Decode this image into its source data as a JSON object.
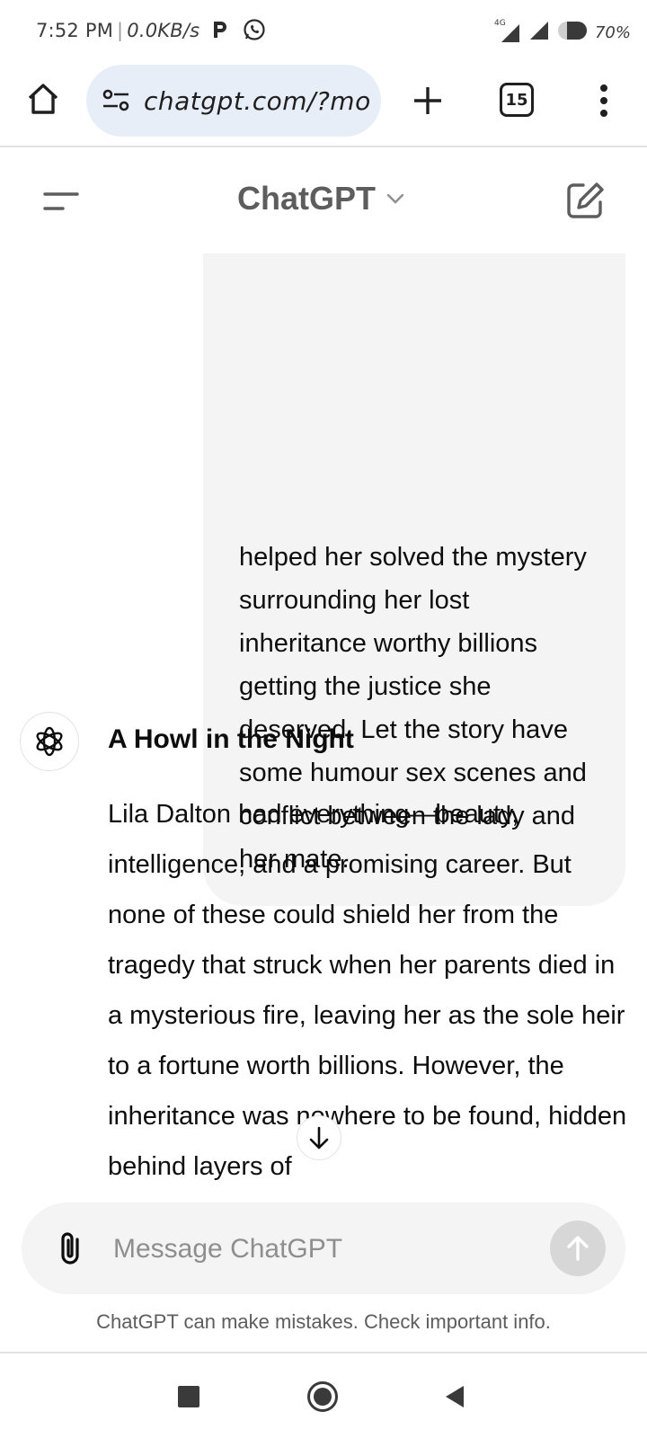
{
  "status_bar": {
    "time": "7:52 PM",
    "separator": "|",
    "network_speed": "0.0KB/s",
    "app_icons": [
      "parking-p-icon",
      "whatsapp-icon"
    ],
    "network_type": "4G",
    "battery_percent": "70%"
  },
  "browser": {
    "url": "chatgpt.com/?mo",
    "tab_count": "15",
    "icons": [
      "home-icon",
      "site-settings-icon",
      "plus-icon",
      "tab-switcher-icon",
      "more-vert-icon"
    ]
  },
  "chat_header": {
    "model_name": "ChatGPT",
    "icons": [
      "sidebar-menu-icon",
      "chevron-down-icon",
      "new-chat-icon"
    ]
  },
  "user_message": {
    "text": "helped her solved the mystery surrounding her lost inheritance worthy billions getting the justice she deserved. Let the story have some humour sex scenes and conflict between the lady and her mate."
  },
  "assistant_message": {
    "avatar_icon": "openai-logo-icon",
    "heading": "A Howl in the Night",
    "body": "Lila Dalton had everything—beauty, intelligence, and a promising career. But none of these could shield her from the tragedy that struck when her parents died in a mysterious fire, leaving her as the sole heir to a fortune worth billions. However, the inheritance was nowhere to be found, hidden behind layers of"
  },
  "scroll_button": {
    "icon": "arrow-down-icon"
  },
  "composer": {
    "placeholder": "Message ChatGPT",
    "value": "",
    "icons": [
      "paperclip-icon",
      "arrow-up-icon"
    ]
  },
  "disclaimer": "ChatGPT can make mistakes. Check important info.",
  "colors": {
    "url_pill_bg": "#e8eef8",
    "bubble_bg": "#f4f4f4",
    "send_disabled": "#d7d7d7",
    "header_title": "#5d5d5d"
  }
}
